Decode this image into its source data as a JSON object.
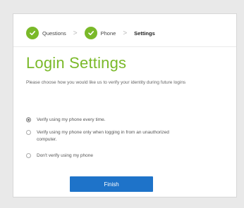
{
  "breadcrumb": {
    "steps": [
      {
        "label": "Questions",
        "status": "complete"
      },
      {
        "label": "Phone",
        "status": "complete"
      },
      {
        "label": "Settings",
        "status": "current"
      }
    ],
    "separator": ">"
  },
  "page": {
    "title": "Login Settings",
    "description": "Please choose how you would like us to verify your identity during future logins"
  },
  "options": [
    {
      "label": "Verify using my phone every time.",
      "selected": true
    },
    {
      "label": "Verify using my phone only when logging in from an unauthorized computer.",
      "selected": false
    },
    {
      "label": "Don't verify using my phone",
      "selected": false
    }
  ],
  "actions": {
    "finish_label": "Finish"
  },
  "colors": {
    "accent_green": "#7ab929",
    "button_blue": "#1e73c9",
    "background": "#e9e9e9"
  },
  "icons": {
    "step_complete": "check-circle-icon"
  }
}
